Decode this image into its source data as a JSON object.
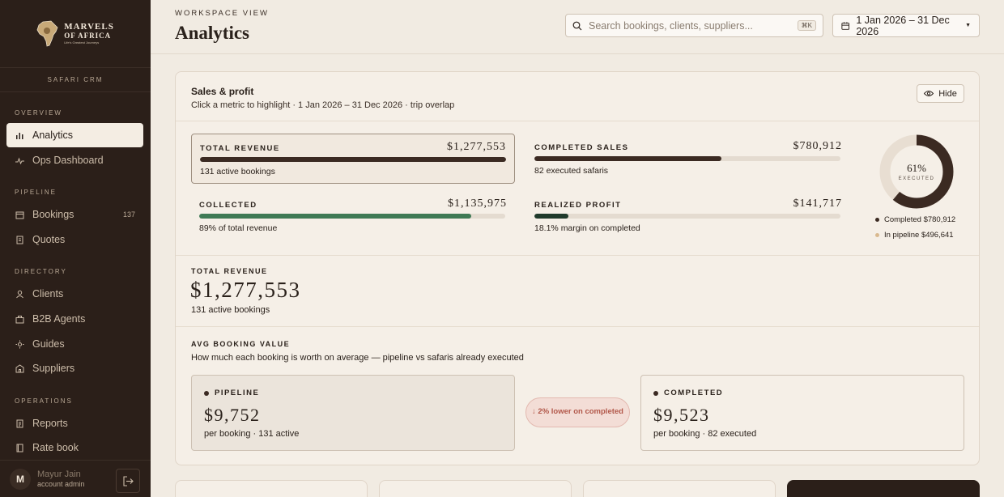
{
  "brand": {
    "name_line1": "MARVELS",
    "name_line2": "OF AFRICA",
    "tagline": "Life's Greatest Journeys",
    "crm_label": "SAFARI CRM"
  },
  "sidebar": {
    "sections": [
      {
        "title": "OVERVIEW"
      },
      {
        "title": "PIPELINE"
      },
      {
        "title": "DIRECTORY"
      },
      {
        "title": "OPERATIONS"
      }
    ],
    "items": [
      {
        "label": "Analytics",
        "icon": "bar-chart-icon",
        "active": true
      },
      {
        "label": "Ops Dashboard",
        "icon": "pulse-icon"
      },
      {
        "label": "Bookings",
        "icon": "calendar-icon",
        "count": "137"
      },
      {
        "label": "Quotes",
        "icon": "quote-doc-icon"
      },
      {
        "label": "Clients",
        "icon": "user-icon"
      },
      {
        "label": "B2B Agents",
        "icon": "briefcase-icon"
      },
      {
        "label": "Guides",
        "icon": "sun-icon"
      },
      {
        "label": "Suppliers",
        "icon": "building-icon"
      },
      {
        "label": "Reports",
        "icon": "document-icon"
      },
      {
        "label": "Rate book",
        "icon": "book-icon"
      }
    ],
    "user": {
      "initial": "M",
      "name": "Mayur Jain",
      "role": "account admin"
    }
  },
  "header": {
    "eyebrow": "WORKSPACE VIEW",
    "title": "Analytics",
    "search_placeholder": "Search bookings, clients, suppliers...",
    "search_shortcut": "⌘K",
    "date_range": "1 Jan 2026 – 31 Dec 2026"
  },
  "sales_profit": {
    "title": "Sales & profit",
    "subtitle": "Click a metric to highlight · 1 Jan 2026 – 31 Dec 2026 · trip overlap",
    "hide_label": "Hide",
    "metrics": [
      {
        "label": "TOTAL REVENUE",
        "value": "$1,277,553",
        "note": "131 active bookings",
        "fill": 1.0,
        "color": "#3b2a22"
      },
      {
        "label": "COMPLETED SALES",
        "value": "$780,912",
        "note": "82 executed safaris",
        "fill": 0.61,
        "color": "#3b2a22"
      },
      {
        "label": "COLLECTED",
        "value": "$1,135,975",
        "note": "89% of total revenue",
        "fill": 0.89,
        "color": "#3f7a55"
      },
      {
        "label": "REALIZED PROFIT",
        "value": "$141,717",
        "note": "18.1% margin on completed",
        "fill": 0.11,
        "color": "#1f3a2b"
      }
    ],
    "donut": {
      "percent_label": "61%",
      "caption": "EXECUTED",
      "fraction": 0.61,
      "color_completed": "#3b2a22",
      "color_pipeline": "#e8ded2"
    },
    "legend": [
      {
        "label": "Completed $780,912",
        "color": "#3b2a22"
      },
      {
        "label": "In pipeline $496,641",
        "color": "#d9b98f"
      }
    ],
    "total_revenue": {
      "label": "TOTAL REVENUE",
      "value": "$1,277,553",
      "note": "131 active bookings"
    },
    "avg_booking": {
      "label": "AVG BOOKING VALUE",
      "subtitle": "How much each booking is worth on average — pipeline vs safaris already executed",
      "pipeline": {
        "label": "PIPELINE",
        "value": "$9,752",
        "note": "per booking · 131 active",
        "color": "#3b2a22"
      },
      "completed": {
        "label": "COMPLETED",
        "value": "$9,523",
        "note": "per booking · 82 executed",
        "color": "#3b2a22"
      },
      "comparison": "2% lower on completed",
      "comparison_color": "#b2584a"
    }
  }
}
